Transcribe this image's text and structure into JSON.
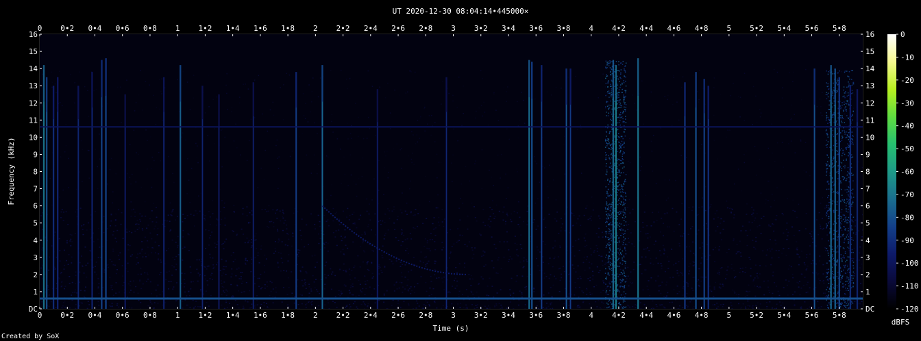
{
  "chart_data": {
    "type": "heatmap",
    "title": "UT 2020-12-30 08:04:14•445000×",
    "xlabel": "Time (s)",
    "ylabel": "Frequency (kHz)",
    "xlim": [
      0,
      5.97
    ],
    "ylim": [
      0,
      16
    ],
    "x_ticks": [
      "0",
      "0•2",
      "0•4",
      "0•6",
      "0•8",
      "1",
      "1•2",
      "1•4",
      "1•6",
      "1•8",
      "2",
      "2•2",
      "2•4",
      "2•6",
      "2•8",
      "3",
      "3•2",
      "3•4",
      "3•6",
      "3•8",
      "4",
      "4•2",
      "4•4",
      "4•6",
      "4•8",
      "5",
      "5•2",
      "5•4",
      "5•6",
      "5•8"
    ],
    "x_tick_values": [
      0,
      0.2,
      0.4,
      0.6,
      0.8,
      1,
      1.2,
      1.4,
      1.6,
      1.8,
      2,
      2.2,
      2.4,
      2.6,
      2.8,
      3,
      3.2,
      3.4,
      3.6,
      3.8,
      4,
      4.2,
      4.4,
      4.6,
      4.8,
      5,
      5.2,
      5.4,
      5.6,
      5.8
    ],
    "y_ticks": [
      "DC",
      "1",
      "2",
      "3",
      "4",
      "5",
      "6",
      "7",
      "8",
      "9",
      "10",
      "11",
      "12",
      "13",
      "14",
      "15",
      "16"
    ],
    "colorbar": {
      "label": "dBFS",
      "ticks": [
        "0",
        "-10",
        "-20",
        "-30",
        "-40",
        "-50",
        "-60",
        "-70",
        "-80",
        "-90",
        "-100",
        "-110",
        "-120"
      ],
      "range": [
        -120,
        0
      ],
      "colors": [
        "#000000",
        "#0a0a3a",
        "#0d1a6a",
        "#13408a",
        "#1a6e8e",
        "#1e9a88",
        "#26c070",
        "#60dc40",
        "#b8f020",
        "#f6f890",
        "#ffffff"
      ]
    },
    "features": {
      "hum_line_khz": 0.6,
      "hum_level_dbfs": -80,
      "tone_line_khz": 10.6,
      "tone_level_dbfs": -100,
      "background_level_dbfs": -115,
      "noise_floor_below_khz": 6,
      "noise_floor_level_dbfs": -108,
      "sferics": [
        {
          "t": 0.03,
          "top_khz": 14.2,
          "level_dbfs": -75
        },
        {
          "t": 0.05,
          "top_khz": 13.5,
          "level_dbfs": -85
        },
        {
          "t": 0.1,
          "top_khz": 13,
          "level_dbfs": -95
        },
        {
          "t": 0.13,
          "top_khz": 13.5,
          "level_dbfs": -98
        },
        {
          "t": 0.28,
          "top_khz": 13,
          "level_dbfs": -100
        },
        {
          "t": 0.38,
          "top_khz": 13.8,
          "level_dbfs": -100
        },
        {
          "t": 0.45,
          "top_khz": 14.5,
          "level_dbfs": -90
        },
        {
          "t": 0.48,
          "top_khz": 14.6,
          "level_dbfs": -88
        },
        {
          "t": 0.62,
          "top_khz": 12.5,
          "level_dbfs": -104
        },
        {
          "t": 0.9,
          "top_khz": 13.5,
          "level_dbfs": -100
        },
        {
          "t": 1.02,
          "top_khz": 14.2,
          "level_dbfs": -82
        },
        {
          "t": 1.18,
          "top_khz": 13,
          "level_dbfs": -102
        },
        {
          "t": 1.3,
          "top_khz": 12.5,
          "level_dbfs": -104
        },
        {
          "t": 1.55,
          "top_khz": 13.2,
          "level_dbfs": -103
        },
        {
          "t": 1.86,
          "top_khz": 13.8,
          "level_dbfs": -92
        },
        {
          "t": 2.05,
          "top_khz": 14.2,
          "level_dbfs": -82
        },
        {
          "t": 2.45,
          "top_khz": 12.8,
          "level_dbfs": -104
        },
        {
          "t": 2.95,
          "top_khz": 13.5,
          "level_dbfs": -102
        },
        {
          "t": 3.55,
          "top_khz": 14.5,
          "level_dbfs": -78
        },
        {
          "t": 3.57,
          "top_khz": 14.4,
          "level_dbfs": -85
        },
        {
          "t": 3.64,
          "top_khz": 14.2,
          "level_dbfs": -92
        },
        {
          "t": 3.82,
          "top_khz": 14,
          "level_dbfs": -88
        },
        {
          "t": 3.85,
          "top_khz": 14,
          "level_dbfs": -95
        },
        {
          "t": 4.16,
          "top_khz": 14.5,
          "level_dbfs": -78
        },
        {
          "t": 4.18,
          "top_khz": 14.2,
          "level_dbfs": -72
        },
        {
          "t": 4.34,
          "top_khz": 14.6,
          "level_dbfs": -75
        },
        {
          "t": 4.68,
          "top_khz": 13.2,
          "level_dbfs": -92
        },
        {
          "t": 4.76,
          "top_khz": 13.8,
          "level_dbfs": -85
        },
        {
          "t": 4.82,
          "top_khz": 13.4,
          "level_dbfs": -90
        },
        {
          "t": 4.85,
          "top_khz": 13,
          "level_dbfs": -95
        },
        {
          "t": 5.62,
          "top_khz": 14,
          "level_dbfs": -88
        },
        {
          "t": 5.74,
          "top_khz": 14.2,
          "level_dbfs": -78
        },
        {
          "t": 5.77,
          "top_khz": 14,
          "level_dbfs": -80
        },
        {
          "t": 5.8,
          "top_khz": 13.5,
          "level_dbfs": -88
        },
        {
          "t": 5.88,
          "top_khz": 13,
          "level_dbfs": -95
        },
        {
          "t": 5.93,
          "top_khz": 12.8,
          "level_dbfs": -98
        }
      ],
      "whistler": {
        "t_start": 2.05,
        "t_end": 3.1,
        "f_start_khz": 6,
        "f_end_khz": 2,
        "level_dbfs": -95
      },
      "storm_bursts": [
        {
          "t_start": 4.1,
          "t_end": 4.25,
          "top_khz": 14.5,
          "level_dbfs": -85
        },
        {
          "t_start": 5.7,
          "t_end": 5.9,
          "top_khz": 14,
          "level_dbfs": -88
        }
      ]
    }
  },
  "credit": "Created by SoX"
}
